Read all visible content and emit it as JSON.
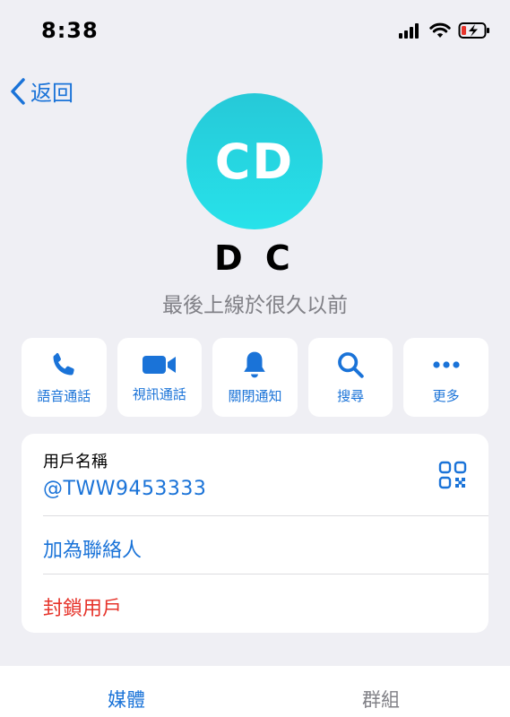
{
  "status_bar": {
    "time": "8:38"
  },
  "nav": {
    "back_label": "返回"
  },
  "profile": {
    "avatar_initials": "CD",
    "avatar_color": "#2ad6e0",
    "name": "D C",
    "last_seen": "最後上線於很久以前"
  },
  "actions": [
    {
      "label": "語音通話",
      "icon": "phone-icon"
    },
    {
      "label": "視訊通話",
      "icon": "video-camera-icon"
    },
    {
      "label": "關閉通知",
      "icon": "bell-icon"
    },
    {
      "label": "搜尋",
      "icon": "search-icon"
    },
    {
      "label": "更多",
      "icon": "more-icon"
    }
  ],
  "info": {
    "username_label": "用戶名稱",
    "username_value": "@TWW9453333",
    "add_contact": "加為聯絡人",
    "block_user": "封鎖用戶"
  },
  "tabs": {
    "media": "媒體",
    "groups": "群組"
  },
  "colors": {
    "accent": "#1a73d8",
    "danger": "#e6342b",
    "background": "#efeff4"
  }
}
